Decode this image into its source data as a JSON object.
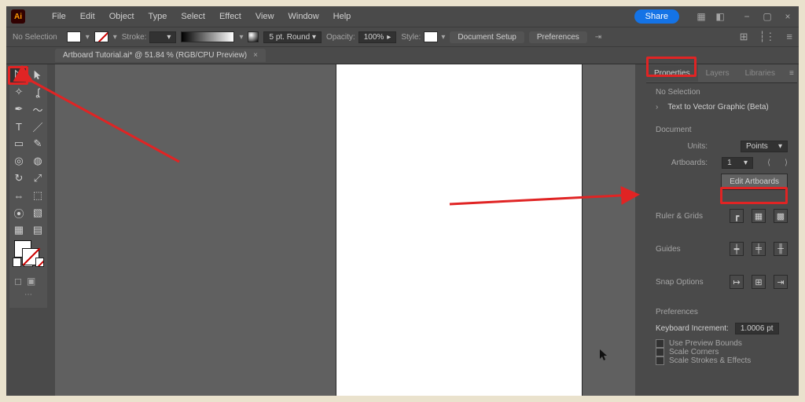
{
  "menubar": {
    "logo": "Ai",
    "menus": [
      "File",
      "Edit",
      "Object",
      "Type",
      "Select",
      "Effect",
      "View",
      "Window",
      "Help"
    ],
    "share": "Share"
  },
  "ctrl": {
    "selection_label": "No Selection",
    "stroke_label": "Stroke:",
    "stroke_val": "",
    "brush_label": "5 pt. Round",
    "opacity_label": "Opacity:",
    "opacity_val": "100%",
    "style_label": "Style:",
    "doc_setup": "Document Setup",
    "preferences": "Preferences"
  },
  "tab": {
    "title": "Artboard Tutorial.ai* @ 51.84 % (RGB/CPU Preview)",
    "close": "×"
  },
  "panel": {
    "tabs": [
      "Properties",
      "Layers",
      "Libraries"
    ],
    "nosel": "No Selection",
    "t2v": "Text to Vector Graphic (Beta)",
    "doc_title": "Document",
    "units_label": "Units:",
    "units_value": "Points",
    "artboards_label": "Artboards:",
    "artboards_value": "1",
    "edit_artboards": "Edit Artboards",
    "ruler_title": "Ruler & Grids",
    "guides_title": "Guides",
    "snap_title": "Snap Options",
    "prefs_title": "Preferences",
    "key_inc_label": "Keyboard Increment:",
    "key_inc_value": "1.0006 pt",
    "cb_preview": "Use Preview Bounds",
    "cb_corners": "Scale Corners",
    "cb_strokes": "Scale Strokes & Effects"
  }
}
